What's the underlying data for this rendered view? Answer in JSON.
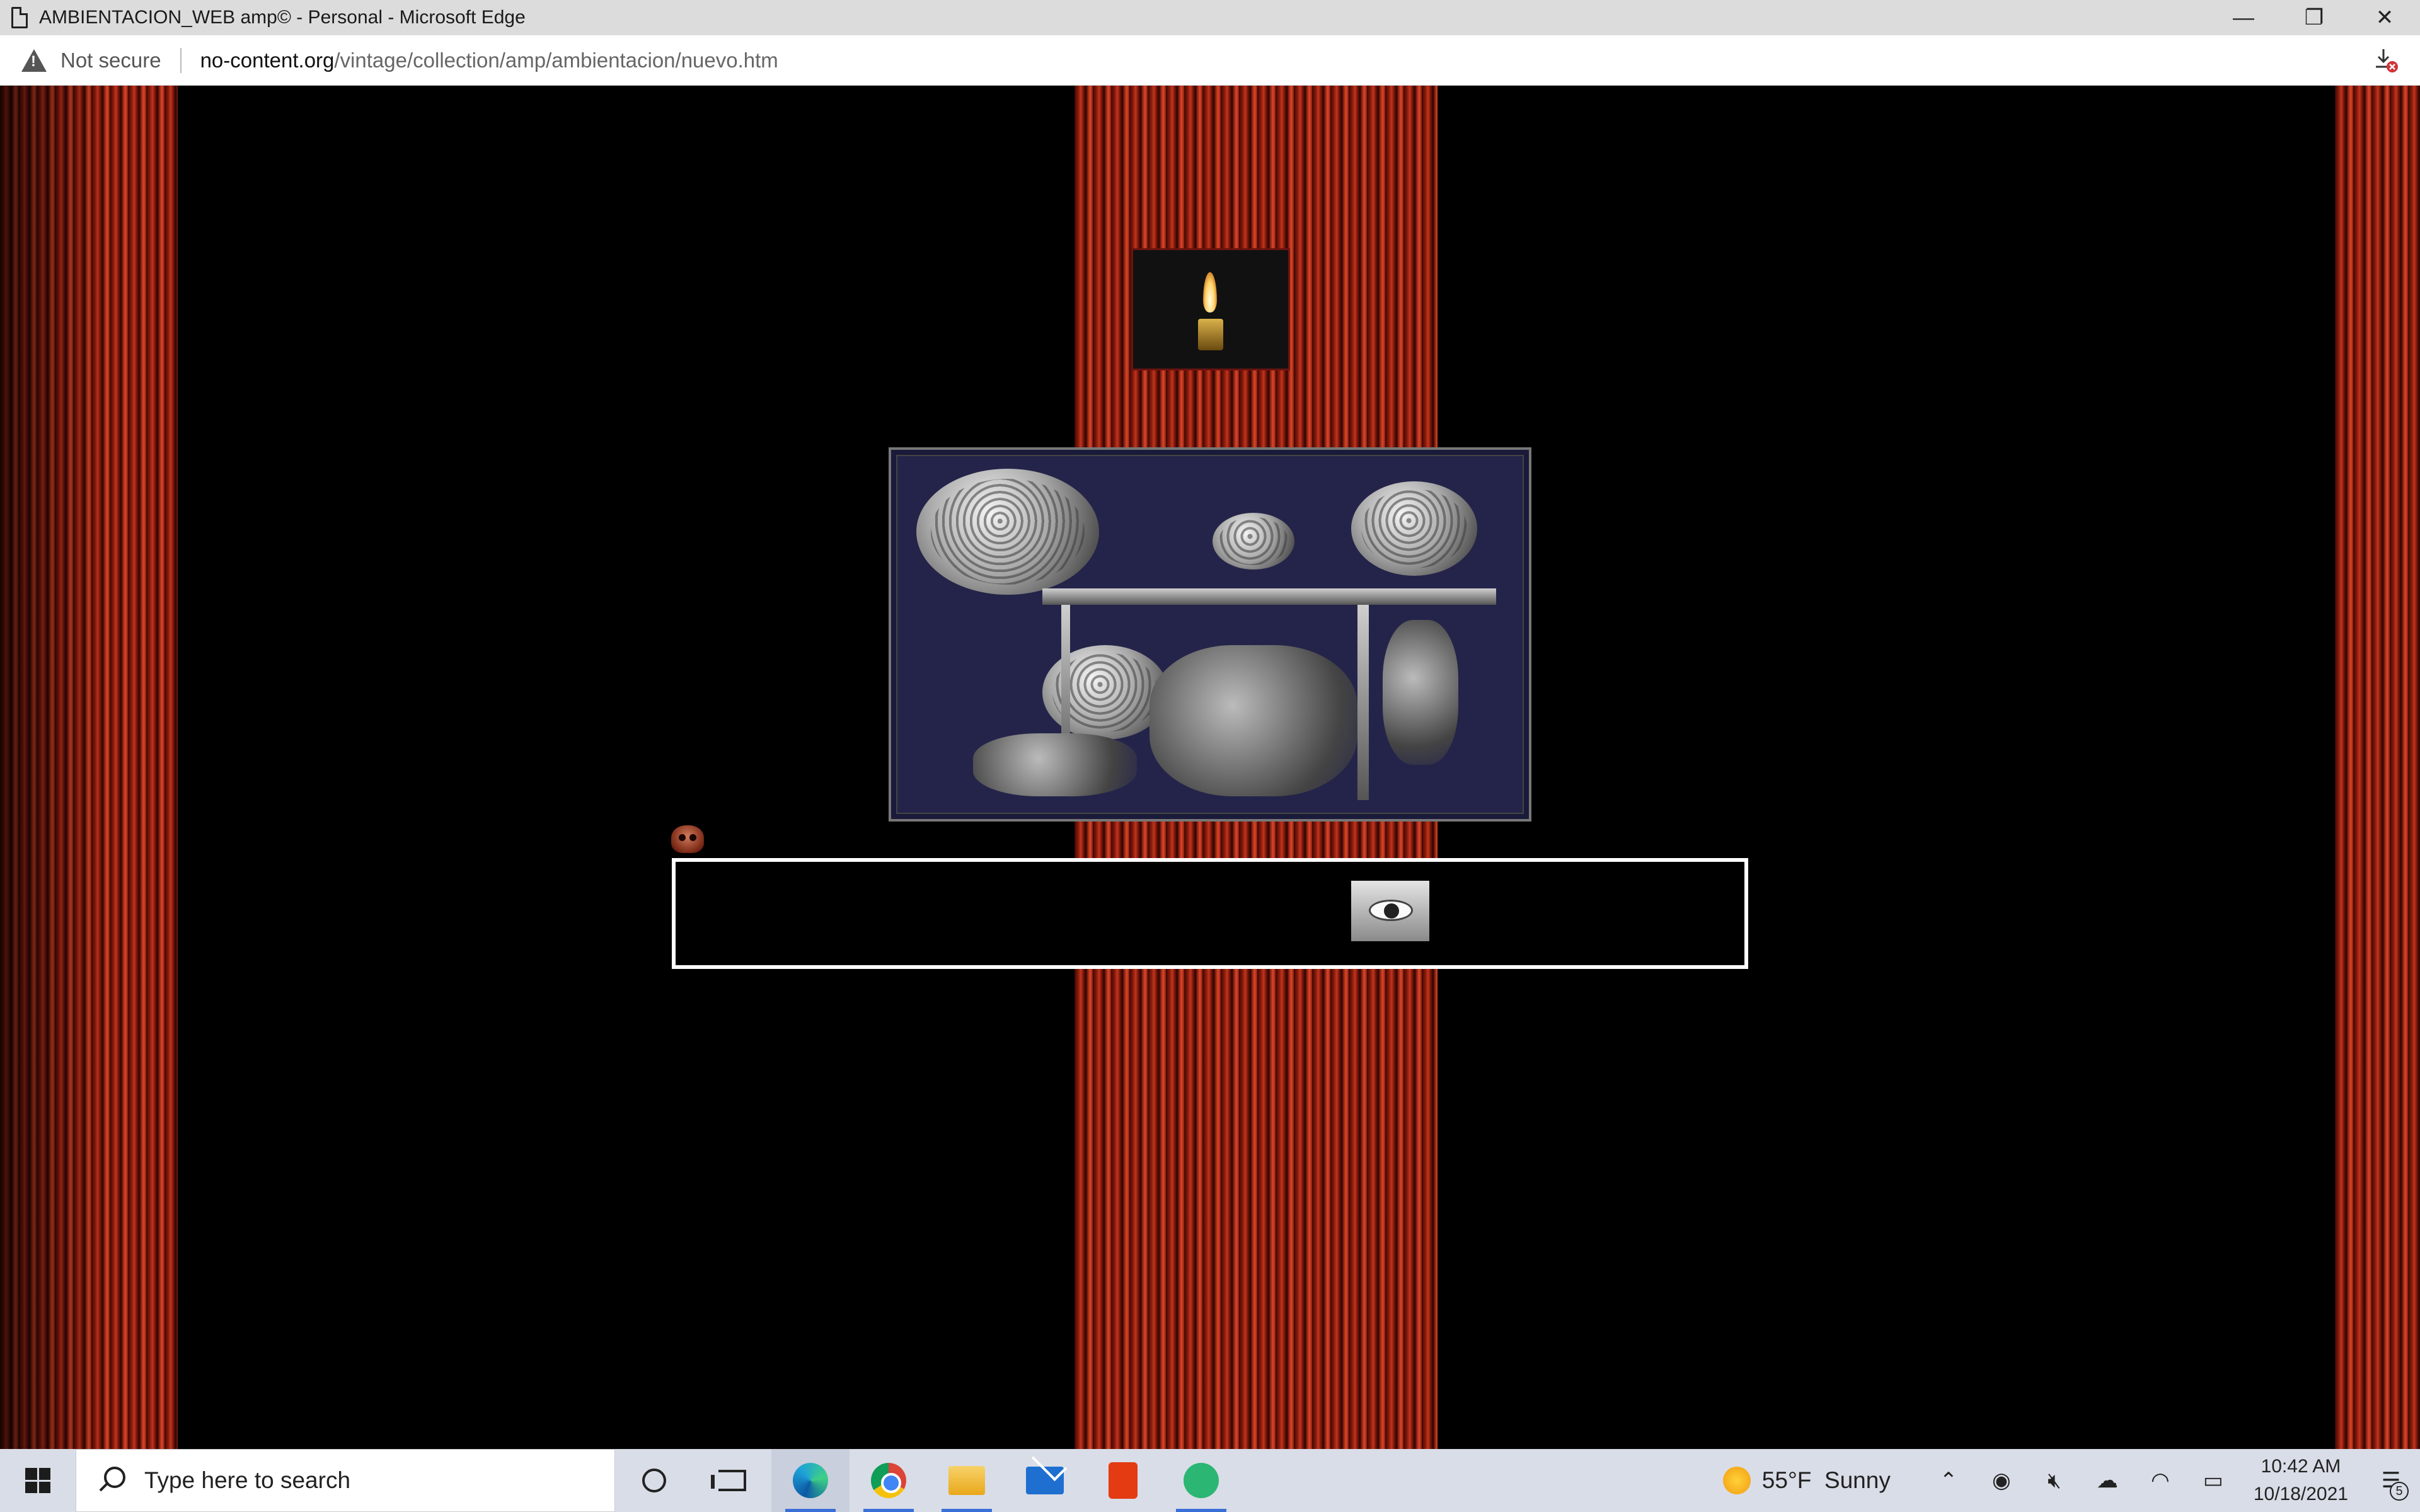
{
  "window": {
    "title": "AMBIENTACION_WEB amp© - Personal - Microsoft Edge",
    "controls": {
      "minimize": "—",
      "restore": "❐",
      "close": "✕"
    }
  },
  "address_bar": {
    "security_label": "Not secure",
    "url_host": "no-content.org",
    "url_path": "/vintage/collection/amp/ambientacion/nuevo.htm"
  },
  "page": {
    "images": [
      "candle-image",
      "brains-scene-image",
      "skull-icon",
      "eye-image"
    ],
    "colors": {
      "curtain": "#c0361c",
      "background": "#000000",
      "box_border": "#ffffff"
    }
  },
  "taskbar": {
    "search_placeholder": "Type here to search",
    "apps": [
      "Cortana",
      "Task View",
      "Microsoft Edge",
      "Google Chrome",
      "File Explorer",
      "Mail",
      "Office",
      "Atom"
    ],
    "weather": {
      "temp": "55°F",
      "condition": "Sunny"
    },
    "clock": {
      "time": "10:42 AM",
      "date": "10/18/2021"
    },
    "notification_count": "5"
  }
}
